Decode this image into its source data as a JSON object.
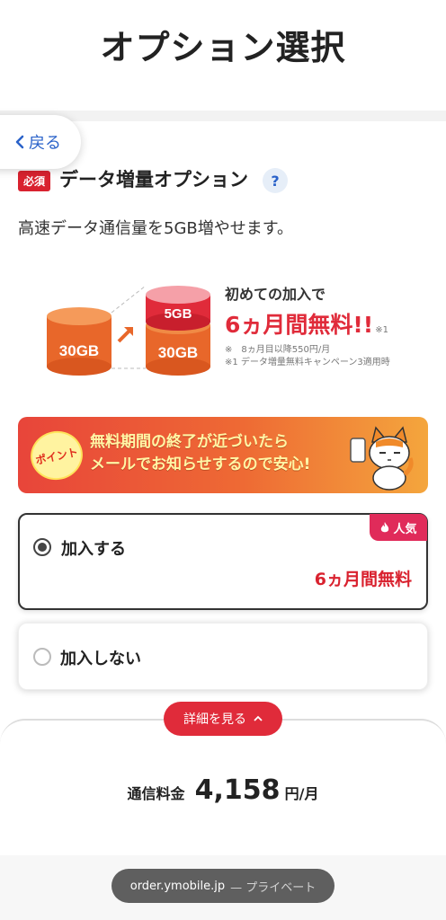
{
  "header": {
    "title": "オプション選択"
  },
  "nav": {
    "back_label": "戻る"
  },
  "section": {
    "required_badge": "必須",
    "title": "データ増量オプション",
    "help_label": "?",
    "description": "高速データ通信量を5GB増やせます。"
  },
  "illustration": {
    "base_label": "30GB",
    "plus_label": "5GB",
    "total_label": "30GB"
  },
  "promo": {
    "line1": "初めての加入で",
    "line2": "6ヵ月間無料!!",
    "line2_mark": "※1",
    "note1": "※　8ヵ月目以降550円/月",
    "note2": "※1 データ増量無料キャンペーン3適用時"
  },
  "banner": {
    "badge": "ポイント",
    "line1": "無料期間の終了が近づいたら",
    "line2": "メールでお知らせするので安心!"
  },
  "options": [
    {
      "label": "加入する",
      "price": "6ヵ月間無料",
      "badge": "人気",
      "selected": true
    },
    {
      "label": "加入しない",
      "selected": false
    }
  ],
  "details": {
    "button_label": "詳細を見る"
  },
  "fee": {
    "label": "通信料金",
    "value": "4,158",
    "unit": "円/月"
  },
  "browser": {
    "url": "order.ymobile.jp",
    "mode": "— プライベート"
  },
  "colors": {
    "accent_red": "#e02b3a",
    "link_blue": "#2a62c9",
    "banner_orange": "#ee6a34"
  }
}
